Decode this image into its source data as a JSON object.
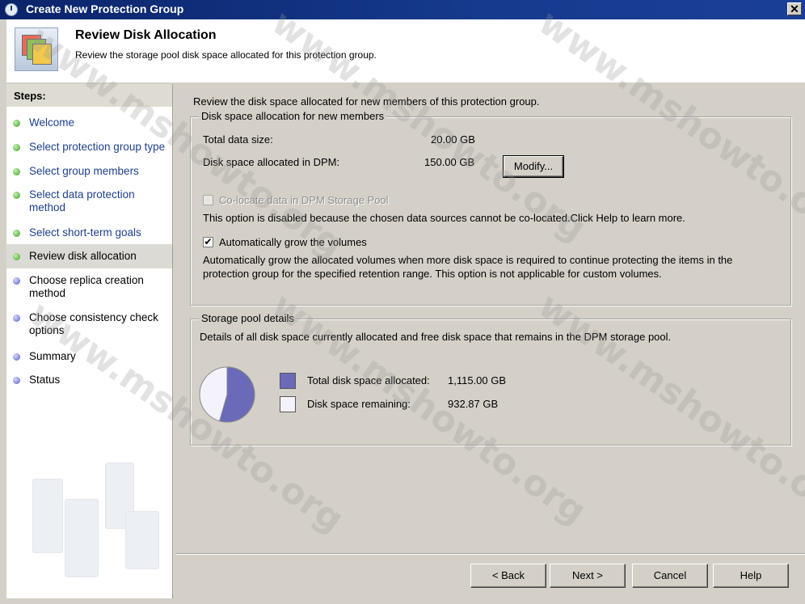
{
  "window": {
    "title": "Create New Protection Group",
    "close_label": "✕"
  },
  "header": {
    "title": "Review Disk Allocation",
    "subtitle": "Review the storage pool disk space allocated for this protection group."
  },
  "sidebar": {
    "heading": "Steps:",
    "steps": [
      {
        "label": "Welcome",
        "state": "done"
      },
      {
        "label": "Select protection group type",
        "state": "done"
      },
      {
        "label": "Select group members",
        "state": "done"
      },
      {
        "label": "Select data protection method",
        "state": "done"
      },
      {
        "label": "Select short-term goals",
        "state": "done"
      },
      {
        "label": "Review disk allocation",
        "state": "current"
      },
      {
        "label": "Choose replica creation method",
        "state": "todo"
      },
      {
        "label": "Choose consistency check options",
        "state": "todo"
      },
      {
        "label": "Summary",
        "state": "todo"
      },
      {
        "label": "Status",
        "state": "todo"
      }
    ]
  },
  "main": {
    "intro": "Review the disk space allocated for new members of this protection group.",
    "allocation_group": {
      "legend": "Disk space allocation for new members",
      "total_label": "Total data size:",
      "total_value": "20.00 GB",
      "allocated_label": "Disk space allocated in DPM:",
      "allocated_value": "150.00 GB",
      "modify_label": "Modify...",
      "colocate_label": "Co-locate data in DPM Storage Pool",
      "colocate_checked": false,
      "colocate_disabled": true,
      "colocate_note": "This option is disabled because the chosen data sources cannot be co-located.Click Help to learn more.",
      "autogrow_label": "Automatically grow the volumes",
      "autogrow_checked": true,
      "autogrow_line1": "Automatically grow the allocated volumes when more disk space is required to continue protecting the items in the",
      "autogrow_line2": "protection group for the specified retention range. This option is not applicable for custom volumes."
    },
    "pool_group": {
      "legend": "Storage pool details",
      "description": "Details of all disk space currently allocated and free disk space that remains in the DPM storage pool.",
      "allocated_label": "Total disk space allocated:",
      "allocated_value": "1,115.00 GB",
      "allocated_gb": 1115.0,
      "allocated_color": "#6a6ab8",
      "remaining_label": "Disk space remaining:",
      "remaining_value": "932.87 GB",
      "remaining_gb": 932.87,
      "remaining_color": "#f4f2fb"
    }
  },
  "buttons": {
    "back": "< Back",
    "next": "Next >",
    "cancel": "Cancel",
    "help": "Help"
  },
  "watermark": "www.mshowto.org"
}
